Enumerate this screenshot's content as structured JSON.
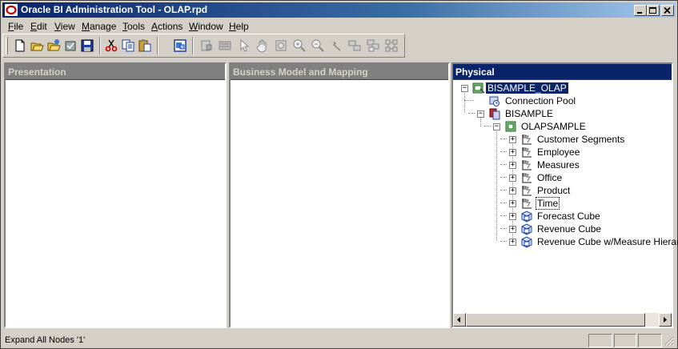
{
  "window": {
    "title": "Oracle BI Administration Tool - OLAP.rpd",
    "icon": "oracle-logo-icon"
  },
  "menu": [
    {
      "label": "File",
      "ul": "F",
      "rest": "ile"
    },
    {
      "label": "Edit",
      "ul": "E",
      "rest": "dit"
    },
    {
      "label": "View",
      "ul": "V",
      "rest": "iew"
    },
    {
      "label": "Manage",
      "ul": "M",
      "rest": "anage"
    },
    {
      "label": "Tools",
      "ul": "T",
      "rest": "ools"
    },
    {
      "label": "Actions",
      "ul": "A",
      "rest": "ctions"
    },
    {
      "label": "Window",
      "ul": "W",
      "rest": "indow"
    },
    {
      "label": "Help",
      "ul": "H",
      "rest": "elp"
    }
  ],
  "toolbar": {
    "buttons": [
      "new-icon",
      "open-icon",
      "open-online-icon",
      "check-in-icon",
      "save-icon",
      "cut-icon",
      "copy-icon",
      "paste-icon",
      "properties-icon",
      "import-icon",
      "query-icon",
      "select-pointer-icon",
      "pan-hand-icon",
      "zoom-fit-icon",
      "zoom-in-icon",
      "zoom-out-icon",
      "join-icon",
      "complex-join-icon",
      "physical-diagram-icon",
      "arrange-icon"
    ]
  },
  "panes": {
    "presentation": {
      "title": "Presentation"
    },
    "business": {
      "title": "Business Model and Mapping"
    },
    "physical": {
      "title": "Physical"
    }
  },
  "tree": [
    {
      "label": "BISAMPLE_OLAP",
      "icon": "database-icon",
      "expander": "−",
      "selected": true
    },
    {
      "label": "Connection Pool",
      "icon": "connection-pool-icon",
      "expander": ""
    },
    {
      "label": "BISAMPLE",
      "icon": "catalog-icon",
      "expander": "−"
    },
    {
      "label": "OLAPSAMPLE",
      "icon": "schema-icon",
      "expander": "−"
    },
    {
      "label": "Customer Segments",
      "icon": "dimension-icon",
      "expander": "+"
    },
    {
      "label": "Employee",
      "icon": "dimension-icon",
      "expander": "+"
    },
    {
      "label": "Measures",
      "icon": "dimension-icon",
      "expander": "+"
    },
    {
      "label": "Office",
      "icon": "dimension-icon",
      "expander": "+"
    },
    {
      "label": "Product",
      "icon": "dimension-icon",
      "expander": "+"
    },
    {
      "label": "Time",
      "icon": "dimension-icon",
      "expander": "+",
      "focused": true
    },
    {
      "label": "Forecast Cube",
      "icon": "cube-icon",
      "expander": "+"
    },
    {
      "label": "Revenue Cube",
      "icon": "cube-icon",
      "expander": "+"
    },
    {
      "label": "Revenue Cube w/Measure Hierar...",
      "icon": "cube-icon",
      "expander": "+"
    }
  ],
  "status": {
    "text": "Expand All Nodes '1'"
  }
}
